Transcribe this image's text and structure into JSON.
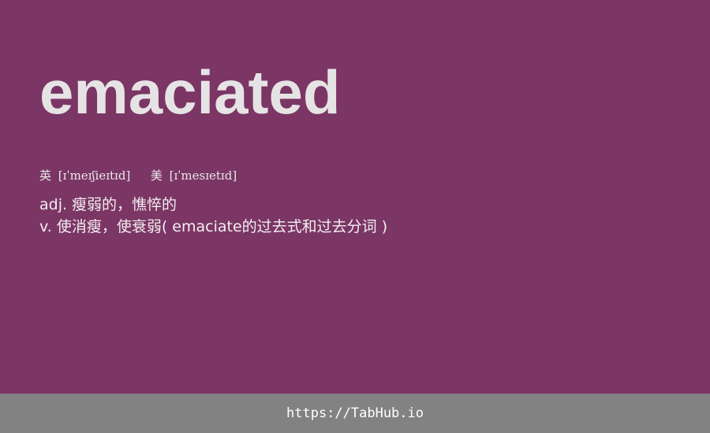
{
  "word": "emaciated",
  "phonetics": {
    "uk_label": "英",
    "uk_ipa": "[ɪˈmeɪʃieɪtɪd]",
    "us_label": "美",
    "us_ipa": "[ɪˈmesɪetɪd]"
  },
  "definitions": [
    "adj. 瘦弱的，憔悴的",
    "v. 使消瘦，使衰弱( emaciate的过去式和过去分词 )"
  ],
  "footer": {
    "link_text": "https://TabHub.io"
  },
  "colors": {
    "background": "#7b3665",
    "footer_background": "#828282",
    "word_text": "#e6e3e5"
  }
}
